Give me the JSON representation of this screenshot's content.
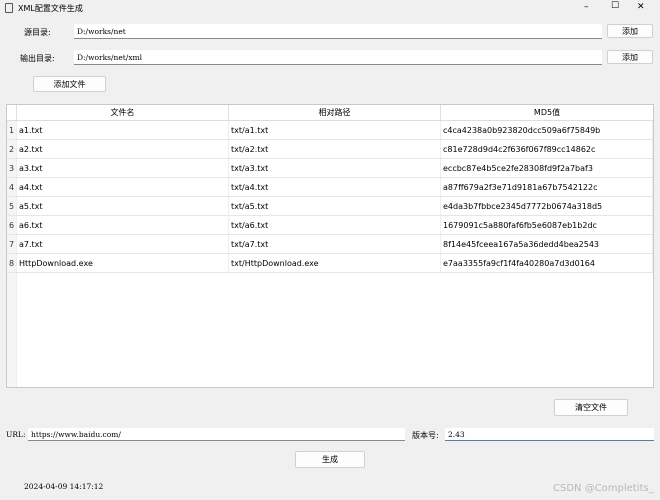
{
  "window": {
    "title": "XML配置文件生成",
    "minimize": "–",
    "maximize": "☐",
    "close": "✕"
  },
  "source": {
    "label": "源目录:",
    "value": "D:/works/net",
    "button": "添加"
  },
  "output": {
    "label": "输出目录:",
    "value": "D:/works/net/xml",
    "button": "添加"
  },
  "add_file": "添加文件",
  "table": {
    "columns": [
      "文件名",
      "相对路径",
      "MD5值"
    ],
    "rows": [
      {
        "n": "1",
        "name": "a1.txt",
        "path": "txt/a1.txt",
        "md5": "c4ca4238a0b923820dcc509a6f75849b"
      },
      {
        "n": "2",
        "name": "a2.txt",
        "path": "txt/a2.txt",
        "md5": "c81e728d9d4c2f636f067f89cc14862c"
      },
      {
        "n": "3",
        "name": "a3.txt",
        "path": "txt/a3.txt",
        "md5": "eccbc87e4b5ce2fe28308fd9f2a7baf3"
      },
      {
        "n": "4",
        "name": "a4.txt",
        "path": "txt/a4.txt",
        "md5": "a87ff679a2f3e71d9181a67b7542122c"
      },
      {
        "n": "5",
        "name": "a5.txt",
        "path": "txt/a5.txt",
        "md5": "e4da3b7fbbce2345d7772b0674a318d5"
      },
      {
        "n": "6",
        "name": "a6.txt",
        "path": "txt/a6.txt",
        "md5": "1679091c5a880faf6fb5e6087eb1b2dc"
      },
      {
        "n": "7",
        "name": "a7.txt",
        "path": "txt/a7.txt",
        "md5": "8f14e45fceea167a5a36dedd4bea2543"
      },
      {
        "n": "8",
        "name": "HttpDownload.exe",
        "path": "txt/HttpDownload.exe",
        "md5": "e7aa3355fa9cf1f4fa40280a7d3d0164"
      }
    ]
  },
  "clear_button": "清空文件",
  "url": {
    "label": "URL:",
    "value": "https://www.baidu.com/"
  },
  "version": {
    "label": "版本号:",
    "value": "2.43"
  },
  "generate_button": "生成",
  "timestamp": "2024-04-09 14:17:12",
  "watermark": "CSDN @Completits_"
}
